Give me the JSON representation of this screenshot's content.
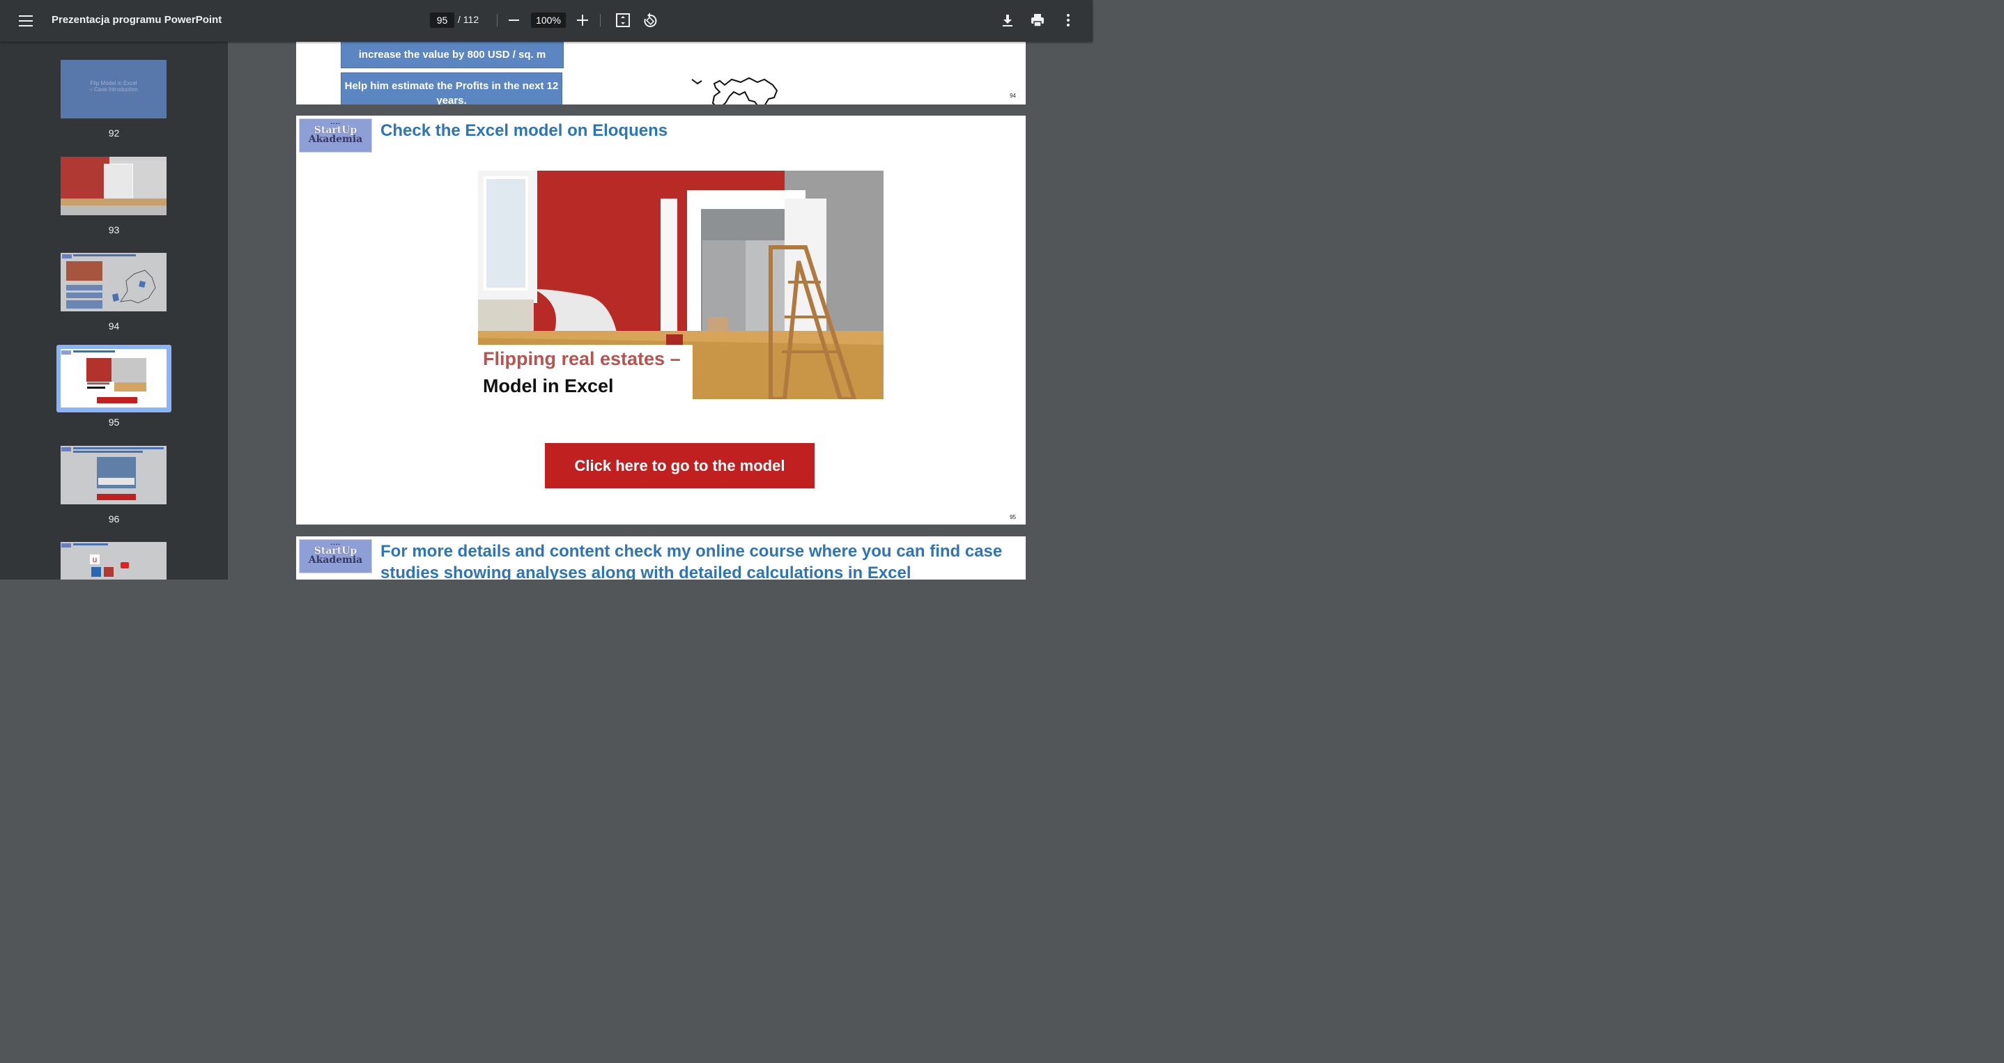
{
  "toolbar": {
    "title": "Prezentacja programu PowerPoint",
    "current_page": "95",
    "total_pages": "/ 112",
    "zoom": "100%"
  },
  "thumbnails": [
    {
      "number": "92",
      "text_line1": "Flip Model in Excel",
      "text_line2": "– Case Introduction"
    },
    {
      "number": "93"
    },
    {
      "number": "94"
    },
    {
      "number": "95",
      "selected": true
    },
    {
      "number": "96"
    }
  ],
  "page94": {
    "box_top_text": "increase the value by 800 USD / sq. m",
    "box_text": "Help him estimate the Profits in the next 12 years.",
    "page_number": "94"
  },
  "page95": {
    "logo_line1": "StartUp",
    "logo_line2": "Akademia",
    "title": "Check the Excel model on Eloquens",
    "image_caption_line1": "Flipping real estates –",
    "image_caption_line2": "Model in Excel",
    "button_label": "Click here to go to the model",
    "page_number": "95"
  },
  "page96": {
    "logo_line1": "StartUp",
    "logo_line2": "Akademia",
    "title": "For more details and content check my online course where you can find case studies showing analyses along with detailed calculations in Excel"
  },
  "colors": {
    "title_blue": "#2e75b6",
    "button_red": "#c0201f",
    "box_blue": "#5b86c2",
    "selected_thumb": "#8ab4f8"
  }
}
